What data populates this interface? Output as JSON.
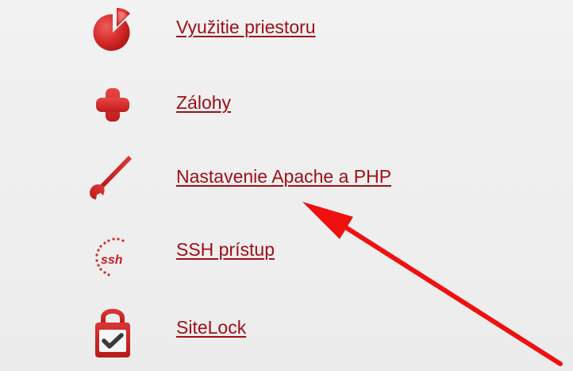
{
  "menu": {
    "items": [
      {
        "label": "Využitie priestoru",
        "icon": "pie-chart-icon"
      },
      {
        "label": "Zálohy",
        "icon": "plus-icon"
      },
      {
        "label": "Nastavenie Apache a PHP",
        "icon": "wrench-icon"
      },
      {
        "label": "SSH prístup",
        "icon": "ssh-icon"
      },
      {
        "label": "SiteLock",
        "icon": "lock-check-icon"
      }
    ],
    "ssh_icon_text": "ssh"
  },
  "colors": {
    "link": "#a20f18",
    "icon_red": "#d72d2d",
    "arrow": "#f01010",
    "background": "#efefef"
  }
}
